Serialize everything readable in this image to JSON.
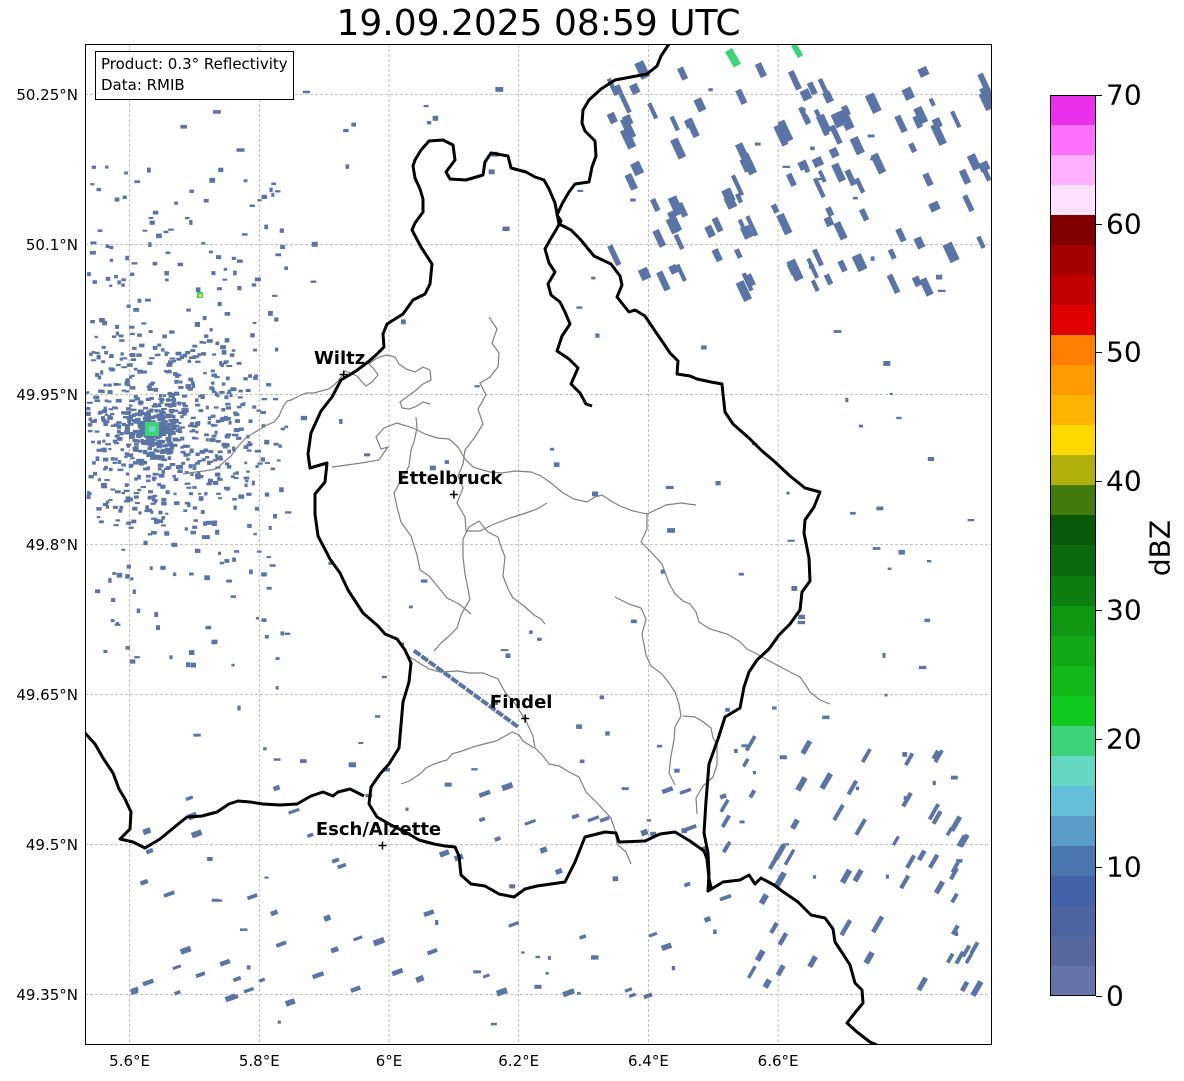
{
  "title": "19.09.2025 08:59 UTC",
  "info": {
    "product": "Product: 0.3° Reflectivity",
    "data": "Data: RMIB"
  },
  "axes": {
    "lat_labels": [
      "50.25°N",
      "50.1°N",
      "49.95°N",
      "49.8°N",
      "49.65°N",
      "49.5°N",
      "49.35°N"
    ],
    "lon_labels": [
      "5.6°E",
      "5.8°E",
      "6°E",
      "6.2°E",
      "6.4°E",
      "6.6°E"
    ],
    "lat_range": [
      49.3,
      50.3
    ],
    "lon_range": [
      5.4,
      6.8
    ]
  },
  "cities": [
    {
      "name": "Wiltz",
      "lon": 5.93,
      "lat": 49.97
    },
    {
      "name": "Ettelbruck",
      "lon": 6.1,
      "lat": 49.85
    },
    {
      "name": "Findel",
      "lon": 6.21,
      "lat": 49.626
    },
    {
      "name": "Esch/Alzette",
      "lon": 5.99,
      "lat": 49.499
    }
  ],
  "radar_site": {
    "lon": 5.505,
    "lat": 49.914,
    "color": "#e00000"
  },
  "colorbar": {
    "unit": "dBZ",
    "min": 0,
    "max": 70,
    "tick_labels": [
      "0",
      "10",
      "20",
      "30",
      "40",
      "50",
      "60",
      "70"
    ],
    "colors": [
      "#6573a8",
      "#57689e",
      "#4d63a2",
      "#4462a8",
      "#4a77b0",
      "#5a9cc8",
      "#64c0d8",
      "#64d8c0",
      "#3dd37a",
      "#11c91e",
      "#12b819",
      "#12a816",
      "#109814",
      "#0d7e10",
      "#0a6a0d",
      "#0a590b",
      "#437a0c",
      "#afb10a",
      "#fed600",
      "#fdb300",
      "#fd9b00",
      "#fd7e00",
      "#e10000",
      "#c00000",
      "#a40000",
      "#7f0000",
      "#ffe0ff",
      "#ffb0ff",
      "#ff70ff",
      "#ea30ea"
    ]
  },
  "styles": {
    "border_color": "#000000",
    "district_color": "#808080",
    "grid_color": "#b0b0b0",
    "echo_color": "#5a74a6"
  }
}
